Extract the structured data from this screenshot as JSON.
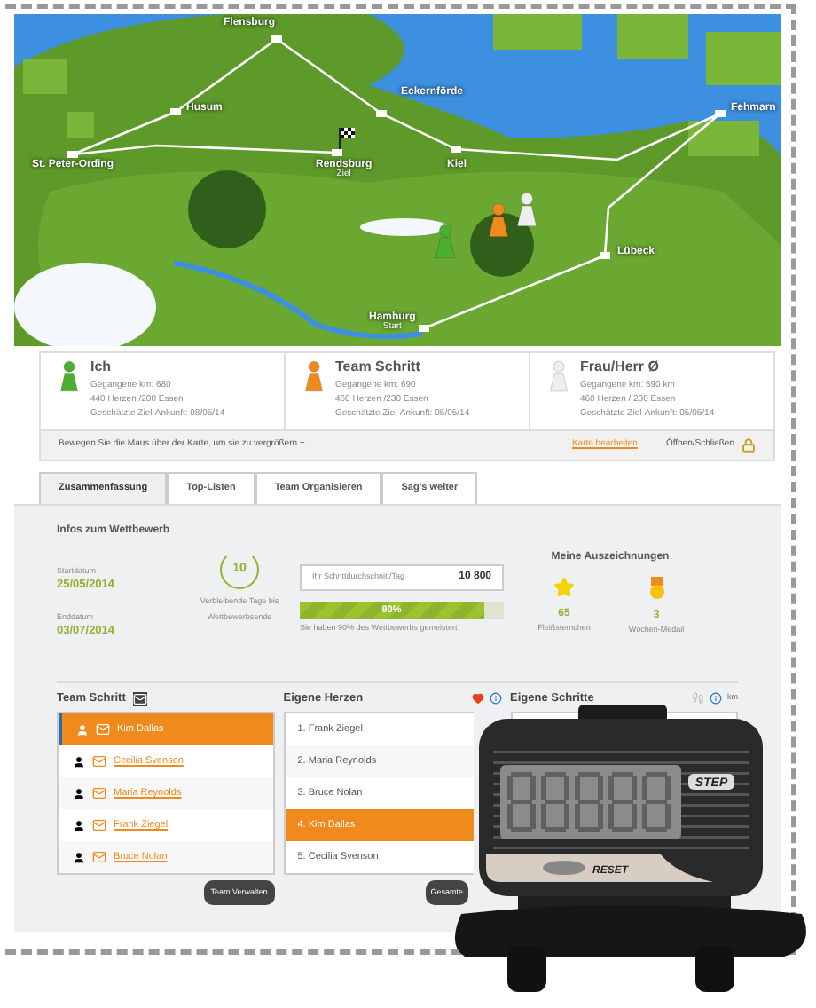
{
  "map": {
    "cities": [
      {
        "name": "Flensburg"
      },
      {
        "name": "Husum"
      },
      {
        "name": "Eckernförde"
      },
      {
        "name": "Fehmarn"
      },
      {
        "name": "St. Peter-Ording"
      },
      {
        "name": "Rendsburg",
        "note": "Ziel"
      },
      {
        "name": "Kiel"
      },
      {
        "name": "Lübeck"
      },
      {
        "name": "Hamburg",
        "note": "Start"
      }
    ]
  },
  "players": [
    {
      "name": "Ich",
      "color": "#4caf32",
      "lines": [
        "Gegangene km: 680",
        "440 Herzen /200 Essen",
        "Geschätzte Ziel-Ankunft: 08/05/14"
      ]
    },
    {
      "name": "Team Schritt",
      "color": "#f08a1c",
      "lines": [
        "Gegangene km: 690",
        "460 Herzen /230 Essen",
        "Geschätzte Ziel-Ankunft: 05/05/14"
      ]
    },
    {
      "name": "Frau/Herr Ø",
      "color": "#eeeeee",
      "lines": [
        "Gegangene km: 690 km",
        "460 Herzen / 230 Essen",
        "Geschätzte Ziel-Ankunft: 05/05/14"
      ]
    }
  ],
  "map_bar": {
    "hint": "Bewegen Sie die Maus über der Karte, um sie zu vergrößern +",
    "link": "Karte bearbeiten",
    "toggle": "Öffnen/Schließen"
  },
  "tabs": [
    {
      "label": "Zusammenfassung",
      "selected": true
    },
    {
      "label": "Top-Listen",
      "selected": false
    },
    {
      "label": "Team Organisieren",
      "selected": false
    },
    {
      "label": "Sag's weiter",
      "selected": false
    }
  ],
  "summary": {
    "title": "Infos zum Wettbewerb",
    "start_label": "Startdatum",
    "start_date": "25/05/2014",
    "end_label": "Enddatum",
    "end_date": "03/07/2014",
    "days_left": "10",
    "days_caption": "Verbleibende Tage bis Wettbewerbsende",
    "average_placeholder": "Ihr Schrittdurchschnitt/Tag",
    "average_value": "10 800",
    "progress": {
      "level": 0.9,
      "reading": "90%",
      "caption": "Sie haben 90% des Wettbewerbs gemeistert"
    },
    "awards_title": "Meine Auszeichnungen",
    "awards": [
      {
        "kind": "star",
        "count": "65",
        "label": "Fleißsternchen"
      },
      {
        "kind": "medal",
        "count": "3",
        "label": "Wochen-Medail"
      }
    ]
  },
  "team": {
    "title": "Team Schritt",
    "members": [
      {
        "name": "Kim Dallas",
        "selected": true
      },
      {
        "name": "Cecilia Svenson",
        "selected": false
      },
      {
        "name": "Maria Reynolds",
        "selected": false
      },
      {
        "name": "Frank Ziegel",
        "selected": false
      },
      {
        "name": "Bruce Nolan",
        "selected": false
      }
    ],
    "button": "Team Verwalten"
  },
  "hearts": {
    "title": "Eigene Herzen",
    "rows": [
      {
        "label": "1. Frank Ziegel",
        "selected": false
      },
      {
        "label": "2. Maria Reynolds",
        "selected": false
      },
      {
        "label": "3. Bruce Nolan",
        "selected": false
      },
      {
        "label": "4. Kim Dallas",
        "selected": true
      },
      {
        "label": "5. Cecilia Svenson",
        "selected": false
      }
    ],
    "button": "Gesamte"
  },
  "steps": {
    "title": "Eigene Schritte",
    "unit": "km"
  },
  "pedometer": {
    "display_label": "STEP",
    "button_label": "RESET"
  }
}
